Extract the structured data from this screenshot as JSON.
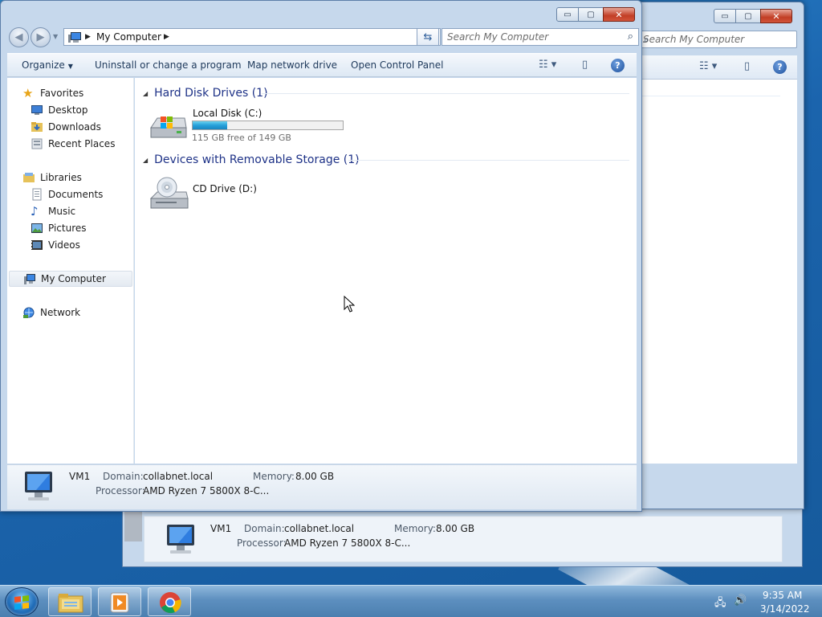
{
  "window": {
    "address_crumb": "My Computer",
    "search_placeholder": "Search My Computer"
  },
  "caption_buttons": {
    "minimize": "▭",
    "maximize": "▢",
    "close": "✕"
  },
  "commandbar": {
    "organize": "Organize",
    "uninstall": "Uninstall or change a program",
    "map_drive": "Map network drive",
    "control_panel": "Open Control Panel"
  },
  "navpane": {
    "favorites": "Favorites",
    "desktop": "Desktop",
    "downloads": "Downloads",
    "recent": "Recent Places",
    "libraries": "Libraries",
    "documents": "Documents",
    "music": "Music",
    "pictures": "Pictures",
    "videos": "Videos",
    "computer": "My Computer",
    "network": "Network"
  },
  "content": {
    "hdd_header": "Hard Disk Drives (1)",
    "removable_header": "Devices with Removable Storage (1)",
    "local_disk": {
      "name": "Local Disk (C:)",
      "free_text": "115 GB free of 149 GB",
      "used_fraction": 0.23
    },
    "cd_drive": {
      "name": "CD Drive (D:)"
    }
  },
  "details": {
    "computer_name": "VM1",
    "domain_label": "Domain:",
    "domain_value": "collabnet.local",
    "memory_label": "Memory:",
    "memory_value": "8.00 GB",
    "processor_label": "Processor:",
    "processor_value": "AMD Ryzen 7 5800X 8-C..."
  },
  "taskbar": {
    "time": "9:35 AM",
    "date": "3/14/2022"
  },
  "colors": {
    "accent": "#1e3287",
    "progress_fill": "#26a0da",
    "close_button": "#c23e25"
  }
}
